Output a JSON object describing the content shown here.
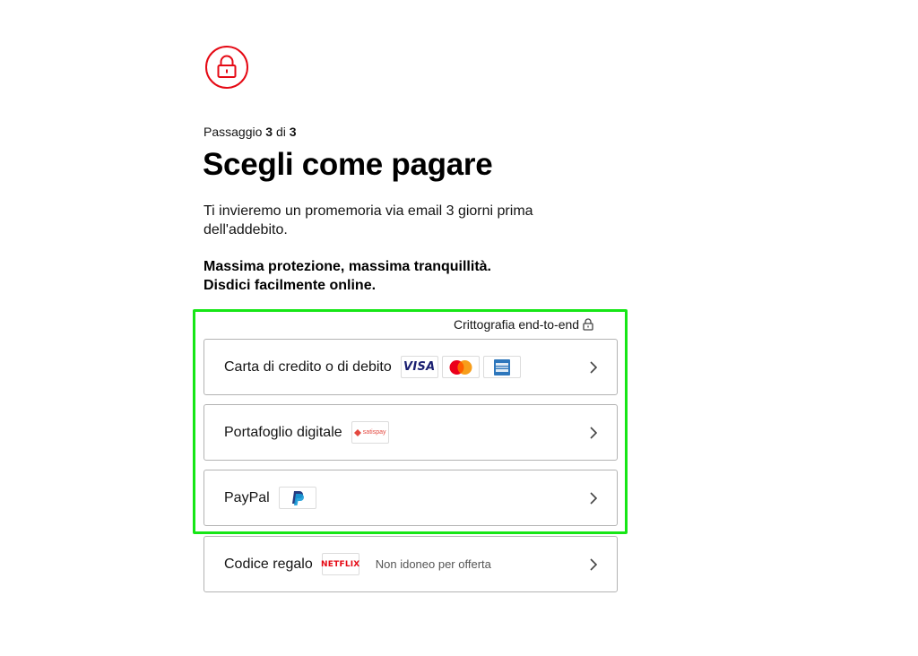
{
  "header": {
    "lock_icon": "lock-icon",
    "brand_color": "#e50914"
  },
  "step": {
    "prefix": "Passaggio",
    "current": "3",
    "separator": "di",
    "total": "3"
  },
  "title": "Scegli come pagare",
  "reminder": "Ti invieremo un promemoria via email 3 giorni prima dell'addebito.",
  "assurance": {
    "line1": "Massima protezione, massima tranquillità.",
    "line2": "Disdici facilmente online."
  },
  "encryption": {
    "label": "Crittografia end-to-end",
    "icon": "lock-icon"
  },
  "highlight_color": "#16e616",
  "payment_methods": [
    {
      "label": "Carta di credito o di debito",
      "logos": [
        "VISA",
        "mastercard-logo",
        "amex-logo"
      ],
      "chevron": "chevron-right-icon"
    },
    {
      "label": "Portafoglio digitale",
      "logos": [
        "satispay"
      ],
      "chevron": "chevron-right-icon"
    },
    {
      "label": "PayPal",
      "logos": [
        "paypal-logo"
      ],
      "chevron": "chevron-right-icon"
    },
    {
      "label": "Codice regalo",
      "logos": [
        "NETFLIX"
      ],
      "note": "Non idoneo per offerta",
      "chevron": "chevron-right-icon"
    }
  ]
}
